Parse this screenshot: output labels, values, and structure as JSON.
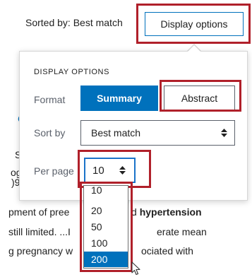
{
  "sort": {
    "sorted_by_text": "Sorted by: Best match",
    "display_options_label": "Display options"
  },
  "panel": {
    "heading": "DISPLAY OPTIONS",
    "format_label": "Format",
    "format_options": [
      "Summary",
      "Abstract"
    ],
    "format_selected": "Summary",
    "sortby_label": "Sort by",
    "sortby_value": "Best match",
    "perpage_label": "Per page",
    "perpage_value": "10"
  },
  "perpage_options": [
    "10",
    "20",
    "50",
    "100",
    "200"
  ],
  "perpage_highlighted": "200",
  "background": {
    "frag_c": "C",
    "frag_s": "S",
    "frag_og": "og",
    "frag_x": ")9",
    "line1_a": "pment of pree",
    "line1_b": "d ",
    "line1_bold": "hypertension",
    "line2_a": "still limited. ...I",
    "line2_b": "erate mean",
    "line3_a": "g pregnancy w",
    "line3_b": "ociated with"
  },
  "colors": {
    "primary": "#0071bc",
    "highlight_box": "#b0202a"
  }
}
